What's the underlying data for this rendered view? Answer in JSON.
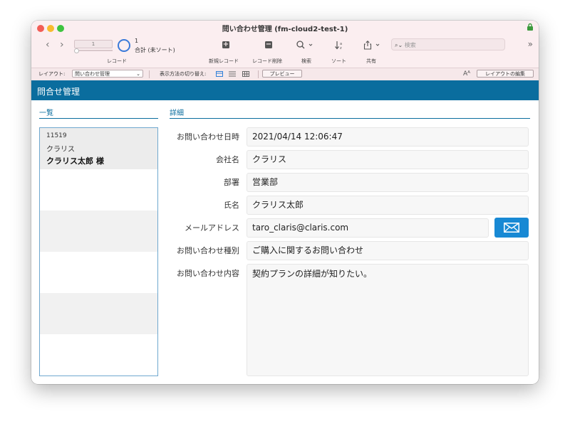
{
  "window": {
    "title": "問い合わせ管理 (fm-cloud2-test-1)"
  },
  "toolbar": {
    "record_current": "1",
    "record_count": "1",
    "record_count_label": "合計 (未ソート)",
    "records_label": "レコード",
    "new_record_label": "新規レコード",
    "delete_record_label": "レコード削除",
    "find_label": "検索",
    "sort_label": "ソート",
    "share_label": "共有",
    "search_placeholder": "検索",
    "more_icon": "»"
  },
  "layout_bar": {
    "layout_label": "レイアウト:",
    "layout_value": "問い合わせ管理",
    "view_as_label": "表示方法の切り替え:",
    "preview_button": "プレビュー",
    "font_size_icon": "Aᴬ",
    "edit_layout_button": "レイアウトの編集"
  },
  "header": {
    "title": "問合せ管理"
  },
  "list": {
    "title": "一覧",
    "records": [
      {
        "id": "11519",
        "company": "クラリス",
        "name": "クラリス太郎 様"
      }
    ]
  },
  "detail": {
    "title": "詳細",
    "fields": [
      {
        "label": "お問い合わせ日時",
        "value": "2021/04/14 12:06:47"
      },
      {
        "label": "会社名",
        "value": "クラリス"
      },
      {
        "label": "部署",
        "value": "営業部"
      },
      {
        "label": "氏名",
        "value": "クラリス太郎"
      },
      {
        "label": "メールアドレス",
        "value": "taro_claris@claris.com"
      },
      {
        "label": "お問い合わせ種別",
        "value": "ご購入に関するお問い合わせ"
      },
      {
        "label": "お問い合わせ内容",
        "value": "契約プランの詳細が知りたい。"
      }
    ]
  },
  "colors": {
    "accent": "#0a6d9e",
    "mail_button": "#1889d4",
    "titlebar": "#fbeef0"
  }
}
